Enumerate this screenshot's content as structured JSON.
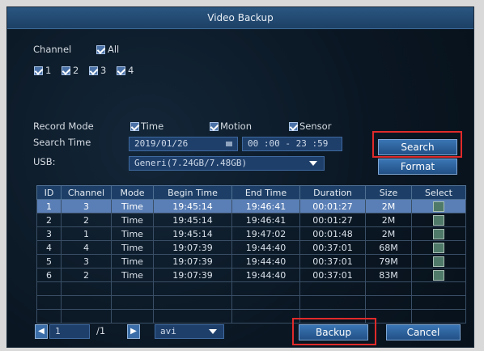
{
  "window": {
    "title": "Video Backup"
  },
  "channel": {
    "label": "Channel",
    "all_label": "All",
    "items": [
      "1",
      "2",
      "3",
      "4"
    ]
  },
  "record_mode": {
    "label": "Record Mode",
    "options": [
      "Time",
      "Motion",
      "Sensor"
    ]
  },
  "search_time": {
    "label": "Search Time",
    "date": "2019/01/26",
    "time_range": "00 :00 - 23 :59"
  },
  "usb": {
    "label": "USB:",
    "device": "Generi(7.24GB/7.48GB)"
  },
  "buttons": {
    "search": "Search",
    "format": "Format",
    "backup": "Backup",
    "cancel": "Cancel"
  },
  "table": {
    "headers": [
      "ID",
      "Channel",
      "Mode",
      "Begin Time",
      "End Time",
      "Duration",
      "Size",
      "Select"
    ],
    "rows": [
      [
        "1",
        "3",
        "Time",
        "19:45:14",
        "19:46:41",
        "00:01:27",
        "2M"
      ],
      [
        "2",
        "2",
        "Time",
        "19:45:14",
        "19:46:41",
        "00:01:27",
        "2M"
      ],
      [
        "3",
        "1",
        "Time",
        "19:45:14",
        "19:47:02",
        "00:01:48",
        "2M"
      ],
      [
        "4",
        "4",
        "Time",
        "19:07:39",
        "19:44:40",
        "00:37:01",
        "68M"
      ],
      [
        "5",
        "3",
        "Time",
        "19:07:39",
        "19:44:40",
        "00:37:01",
        "79M"
      ],
      [
        "6",
        "2",
        "Time",
        "19:07:39",
        "19:44:40",
        "00:37:01",
        "83M"
      ]
    ],
    "selected_row": 1
  },
  "pager": {
    "current": "1",
    "total": "/1",
    "format": "avi"
  },
  "colors": {
    "highlight_box": "#e02a2a",
    "selected_row": "#5a7fb6"
  }
}
